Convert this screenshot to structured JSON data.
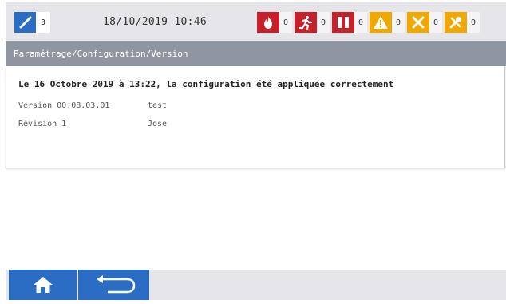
{
  "status": {
    "ok_icon": "check-icon",
    "ok_count": "3",
    "datetime": "18/10/2019 10:46"
  },
  "alarms": [
    {
      "icon": "fire-icon",
      "count": "0",
      "color": "#c8202a"
    },
    {
      "icon": "evacuation-icon",
      "count": "0",
      "color": "#c8202a"
    },
    {
      "icon": "fire-door-icon",
      "count": "0",
      "color": "#c8202a"
    },
    {
      "icon": "warning-icon",
      "count": "0",
      "color": "#f0a800"
    },
    {
      "icon": "fault-icon",
      "count": "0",
      "color": "#f0a800"
    },
    {
      "icon": "maintenance-icon",
      "count": "0",
      "color": "#f0a800"
    }
  ],
  "breadcrumb": "Paramétrage/Configuration/Version",
  "content": {
    "message": "Le 16 Octobre 2019 à 13:22, la configuration été appliquée correctement",
    "rows": [
      {
        "label": "Version 00.08.03.01",
        "value": "test"
      },
      {
        "label": "Révision 1",
        "value": "Jose"
      }
    ]
  },
  "nav": {
    "home_icon": "home-icon",
    "back_icon": "back-arrow-icon"
  }
}
